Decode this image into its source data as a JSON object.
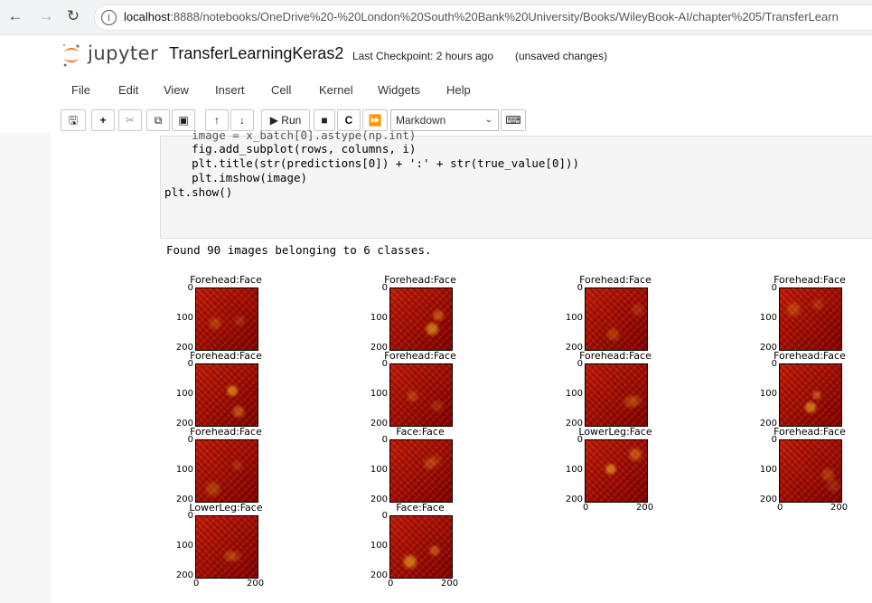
{
  "browser": {
    "url_host": "localhost",
    "url_rest": ":8888/notebooks/OneDrive%20-%20London%20South%20Bank%20University/Books/WileyBook-AI/chapter%205/TransferLearn"
  },
  "header": {
    "brand": "jupyter",
    "notebook_title": "TransferLearningKeras2",
    "checkpoint": "Last Checkpoint: 2 hours ago",
    "status": "(unsaved changes)"
  },
  "menu": [
    "File",
    "Edit",
    "View",
    "Insert",
    "Cell",
    "Kernel",
    "Widgets",
    "Help"
  ],
  "toolbar": {
    "run_label": "Run",
    "cell_type": "Markdown",
    "icons": [
      "save-icon",
      "add-icon",
      "cut-icon",
      "copy-icon",
      "paste-icon",
      "move-up-icon",
      "move-down-icon",
      "run-icon",
      "stop-icon",
      "restart-icon",
      "fast-forward-icon",
      "keyboard-icon"
    ]
  },
  "code_lines": [
    "    image = x_batch[0].astype(np.int)",
    "    fig.add_subplot(rows, columns, i)",
    "    plt.title(str(predictions[0]) + ':' + str(true_value[0]))",
    "    plt.imshow(image)",
    "plt.show()"
  ],
  "output": {
    "found_text": "Found 90 images belonging to 6 classes.",
    "y_ticks": [
      "0",
      "100",
      "200"
    ],
    "x_ticks": [
      "0",
      "200"
    ],
    "plot_titles": [
      "Forehead:Face",
      "Forehead:Face",
      "Forehead:Face",
      "Forehead:Face",
      "Forehead:Face",
      "Forehead:Face",
      "Forehead:Face",
      "Forehead:Face",
      "Forehead:Face",
      "Face:Face",
      "LowerLeg:Face",
      "Forehead:Face",
      "LowerLeg:Face",
      "Face:Face"
    ]
  },
  "colors": {
    "accent": "#f37726",
    "heat_dark": "#7a0000",
    "heat_mid": "#c41e0a",
    "heat_hot": "#f0c020"
  }
}
